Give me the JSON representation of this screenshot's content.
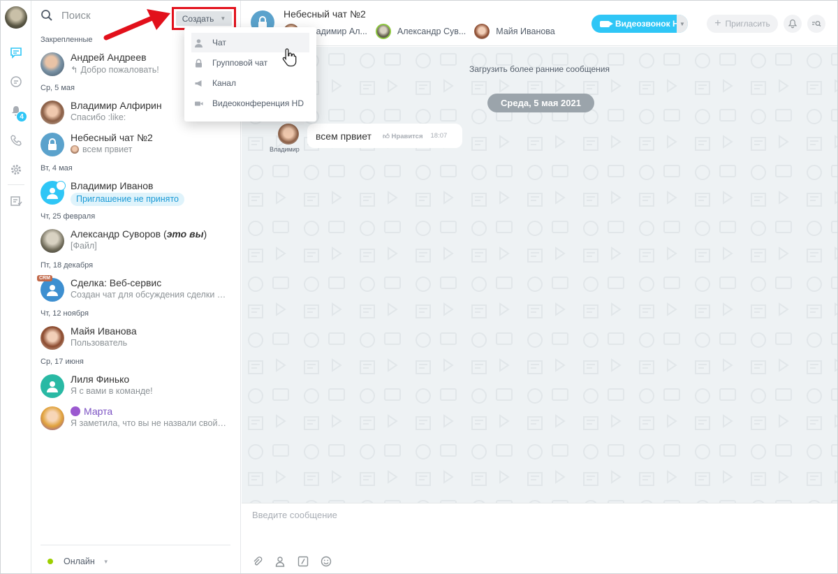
{
  "rail": {
    "badge_count": "4"
  },
  "search": {
    "placeholder": "Поиск"
  },
  "create_button": {
    "label": "Создать"
  },
  "create_menu": [
    {
      "label": "Чат",
      "icon": "person-icon",
      "highlighted": true
    },
    {
      "label": "Групповой чат",
      "icon": "lock-icon",
      "highlighted": false
    },
    {
      "label": "Канал",
      "icon": "megaphone-icon",
      "highlighted": false
    },
    {
      "label": "Видеоконференция HD",
      "icon": "video-camera-icon",
      "highlighted": false
    }
  ],
  "sections": {
    "pinned": "Закрепленные",
    "may5": "Ср, 5 мая",
    "may4": "Вт, 4 мая",
    "feb25": "Чт, 25 февраля",
    "dec18": "Пт, 18 декабря",
    "nov12": "Чт, 12 ноября",
    "jun17": "Ср, 17 июня"
  },
  "chats": {
    "andrey": {
      "title": "Андрей Андреев",
      "subtitle": "Добро пожаловать!"
    },
    "alfirin": {
      "title": "Владимир Алфирин",
      "subtitle": "Спасибо :like:"
    },
    "sky": {
      "title": "Небесный чат №2",
      "subtitle": "всем првиет"
    },
    "ivanov": {
      "title": "Владимир Иванов",
      "subtitle": "Приглашение не принято"
    },
    "suvorov": {
      "title": "Александр Суворов (",
      "title_em": "это вы",
      "title_end": ")",
      "subtitle": "[Файл]"
    },
    "deal": {
      "title": "Сделка: Веб-сервис",
      "subtitle": "Создан чат для обсуждения сделки …",
      "badge": "CRM"
    },
    "maya": {
      "title": "Майя Иванова",
      "subtitle": "Пользователь"
    },
    "lilya": {
      "title": "Лиля Финько",
      "subtitle": "Я с вами в команде!"
    },
    "marta": {
      "title": "Марта",
      "subtitle": "Я заметила, что вы не назвали свой…"
    }
  },
  "status": {
    "label": "Онлайн",
    "color": "#9dcf00"
  },
  "header": {
    "title": "Небесный чат №2",
    "members": [
      "Владимир Ал...",
      "Александр Сув...",
      "Майя Иванова"
    ],
    "video_button": "Видеозвонок HD",
    "invite_button": "Пригласить"
  },
  "chat_area": {
    "load_more": "Загрузить более ранние сообщения",
    "date": "Среда, 5 мая 2021",
    "message": {
      "author": "Владимир",
      "text": "всем првиет",
      "like": "Нравится",
      "time": "18:07"
    }
  },
  "composer": {
    "placeholder": "Введите сообщение"
  },
  "colors": {
    "accent": "#2fc6f6",
    "highlight_border": "#e2101b",
    "chat_bg": "#eef2f4"
  }
}
